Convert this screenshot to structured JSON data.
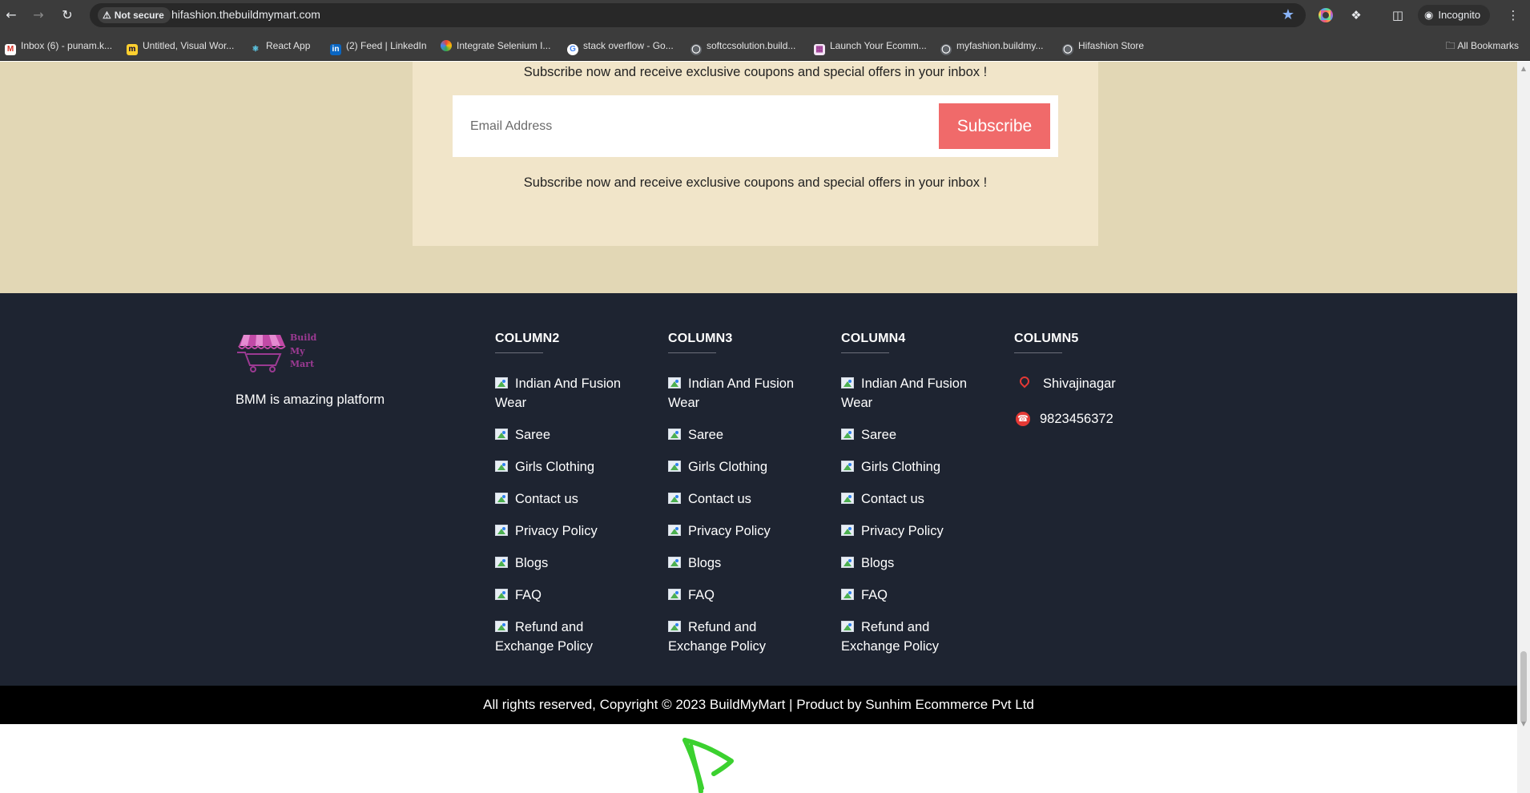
{
  "browser": {
    "security_label": "Not secure",
    "url": "hifashion.thebuildmymart.com",
    "incognito_label": "Incognito",
    "bookmarks": [
      {
        "label": "Inbox (6) - punam.k...",
        "icon": "gmail-icon"
      },
      {
        "label": "Untitled, Visual Wor...",
        "icon": "miro-icon"
      },
      {
        "label": "React App",
        "icon": "react-icon"
      },
      {
        "label": "(2) Feed | LinkedIn",
        "icon": "linkedin-icon"
      },
      {
        "label": "Integrate Selenium I...",
        "icon": "chrome-icon"
      },
      {
        "label": "stack overflow - Go...",
        "icon": "google-icon"
      },
      {
        "label": "softccsolution.build...",
        "icon": "globe-icon"
      },
      {
        "label": "Launch Your Ecomm...",
        "icon": "store-icon"
      },
      {
        "label": "myfashion.buildmy...",
        "icon": "globe-icon"
      },
      {
        "label": "Hifashion Store",
        "icon": "globe-icon"
      }
    ],
    "all_bookmarks_label": "All Bookmarks"
  },
  "newsletter": {
    "text_top": "Subscribe now and receive exclusive coupons and special offers in your inbox !",
    "email_placeholder": "Email Address",
    "button_label": "Subscribe",
    "text_bottom": "Subscribe now and receive exclusive coupons and special offers in your inbox !"
  },
  "footer": {
    "logo_text": [
      "Build",
      "My",
      "Mart"
    ],
    "tagline": "BMM is amazing platform",
    "columns": [
      {
        "title": "COLUMN2",
        "links": [
          "Indian And Fusion Wear",
          "Saree",
          "Girls Clothing",
          "Contact us",
          "Privacy Policy",
          "Blogs",
          "FAQ",
          "Refund and Exchange Policy"
        ]
      },
      {
        "title": "COLUMN3",
        "links": [
          "Indian And Fusion Wear",
          "Saree",
          "Girls Clothing",
          "Contact us",
          "Privacy Policy",
          "Blogs",
          "FAQ",
          "Refund and Exchange Policy"
        ]
      },
      {
        "title": "COLUMN4",
        "links": [
          "Indian And Fusion Wear",
          "Saree",
          "Girls Clothing",
          "Contact us",
          "Privacy Policy",
          "Blogs",
          "FAQ",
          "Refund and Exchange Policy"
        ]
      }
    ],
    "column5": {
      "title": "COLUMN5",
      "address": "Shivajinagar",
      "phone": "9823456372"
    }
  },
  "copyright": "All rights reserved, Copyright © 2023 BuildMyMart | Product by Sunhim Ecommerce Pvt Ltd",
  "colors": {
    "newsletter_bg": "#e2d7b5",
    "subscribe_button": "#f06a6a",
    "footer_bg": "#1e2431",
    "copyright_bg": "#000000",
    "annotation_arrow": "#3bd12f"
  }
}
